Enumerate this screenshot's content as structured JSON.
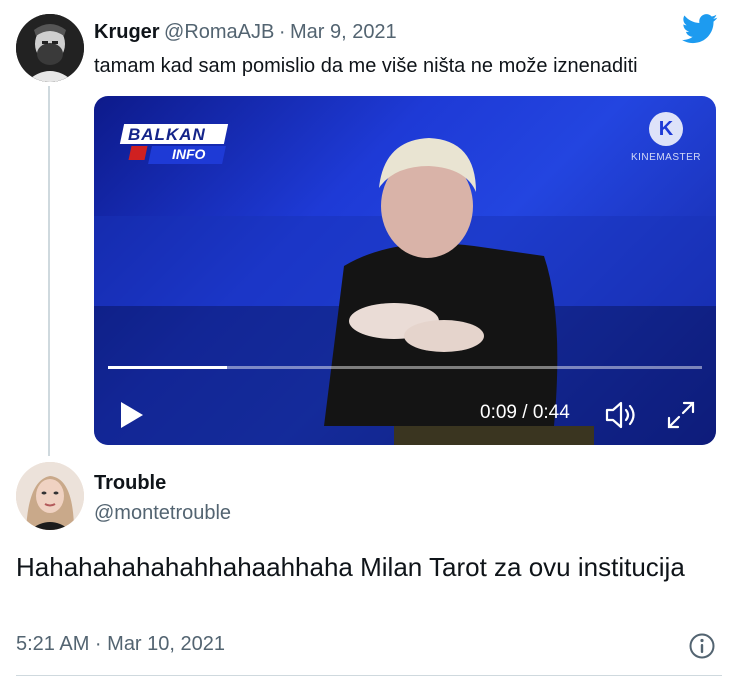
{
  "tweet1": {
    "display_name": "Kruger",
    "handle": "@RomaAJB",
    "separator": "·",
    "date": "Mar 9, 2021",
    "text": "tamam kad sam pomislio da me više ništa ne može iznenaditi",
    "video": {
      "channel_logo_top": "BALKAN",
      "channel_logo_bottom": "INFO",
      "watermark": "KINEMASTER",
      "watermark_letter": "K",
      "time_display": "0:09 / 0:44",
      "progress": 0.2
    }
  },
  "reply": {
    "display_name": "Trouble",
    "handle": "@montetrouble",
    "text": "Hahahahahahahhahaahhaha Milan Tarot za ovu institucija",
    "timestamp": "5:21 AM · Mar 10, 2021"
  },
  "colors": {
    "twitter_blue": "#1d9bf0",
    "secondary_text": "#536471",
    "thread_line": "#cfd9de"
  },
  "icons": [
    "twitter-logo-icon",
    "play-icon",
    "volume-icon",
    "fullscreen-icon",
    "info-icon"
  ]
}
